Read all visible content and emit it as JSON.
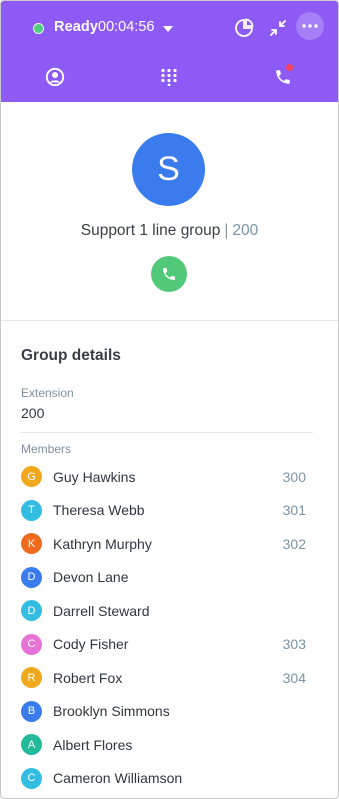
{
  "header": {
    "status_label": "Ready",
    "timer": "00:04:56",
    "status_color": "#4fce7b",
    "background_color": "#8e5af6",
    "icons": [
      "pie-chart-icon",
      "minimize-icon",
      "more-icon"
    ],
    "tabs": [
      {
        "name": "contacts-tab",
        "icon": "contact-icon"
      },
      {
        "name": "dialpad-tab",
        "icon": "dialpad-icon"
      },
      {
        "name": "calls-tab",
        "icon": "phone-icon",
        "has_notification": true
      }
    ]
  },
  "profile": {
    "avatar_letter": "S",
    "avatar_color": "#3a7bed",
    "group_name": "Support 1 line group",
    "separator": "|",
    "extension": "200",
    "call_button_color": "#52c879"
  },
  "details": {
    "title": "Group details",
    "extension_label": "Extension",
    "extension_value": "200",
    "members_label": "Members",
    "members": [
      {
        "initial": "G",
        "name": "Guy Hawkins",
        "ext": "300",
        "color": "#f0a81d"
      },
      {
        "initial": "T",
        "name": "Theresa Webb",
        "ext": "301",
        "color": "#33bde3"
      },
      {
        "initial": "K",
        "name": "Kathryn Murphy",
        "ext": "302",
        "color": "#f06b1e"
      },
      {
        "initial": "D",
        "name": "Devon Lane",
        "ext": "",
        "color": "#3a7bed"
      },
      {
        "initial": "D",
        "name": "Darrell Steward",
        "ext": "",
        "color": "#33bde3"
      },
      {
        "initial": "C",
        "name": "Cody Fisher",
        "ext": "303",
        "color": "#e873d6"
      },
      {
        "initial": "R",
        "name": "Robert Fox",
        "ext": "304",
        "color": "#f0a81d"
      },
      {
        "initial": "B",
        "name": "Brooklyn Simmons",
        "ext": "",
        "color": "#3a7bed"
      },
      {
        "initial": "A",
        "name": "Albert Flores",
        "ext": "",
        "color": "#22b99a"
      },
      {
        "initial": "C",
        "name": "Cameron Williamson",
        "ext": "",
        "color": "#33bde3"
      }
    ]
  }
}
